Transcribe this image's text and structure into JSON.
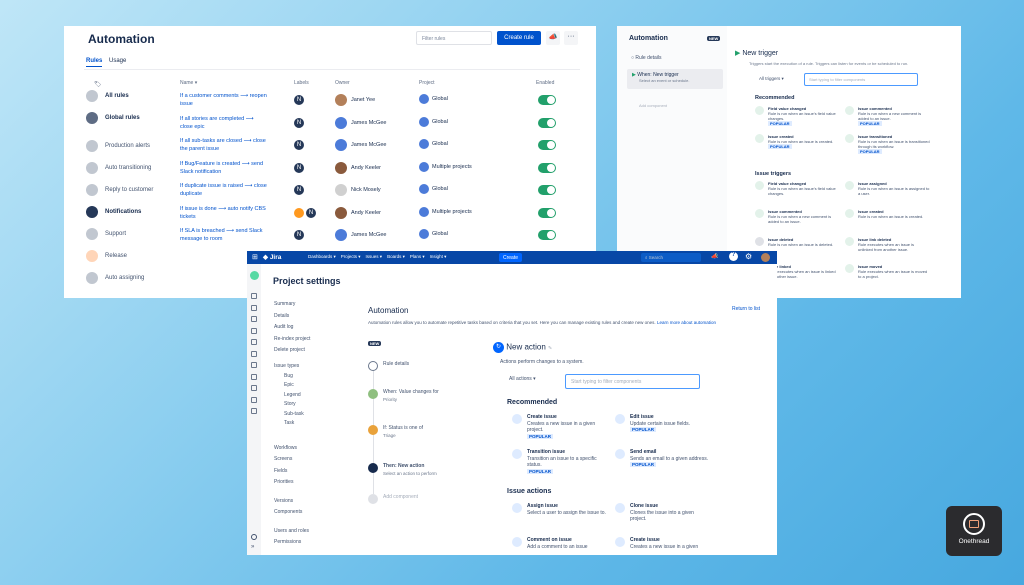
{
  "rules_panel": {
    "title": "Automation",
    "filter_placeholder": "Filter rules",
    "create_rule": "Create rule",
    "tabs": [
      "Rules",
      "Usage"
    ],
    "columns": {
      "name": "Name",
      "labels": "Labels",
      "owner": "Owner",
      "project": "Project",
      "enabled": "Enabled"
    },
    "sidebar": [
      "All rules",
      "Global rules",
      "Production alerts",
      "Auto transitioning",
      "Reply to customer",
      "Notifications",
      "Support",
      "Release",
      "Auto assigning"
    ],
    "sidebar_colors": [
      "#c1c7d0",
      "#5e6c84",
      "#c1c7d0",
      "#c1c7d0",
      "#c1c7d0",
      "#253858",
      "#c1c7d0",
      "#ffd5b8",
      "#c1c7d0"
    ],
    "rows": [
      {
        "name1": "If a customer comments ⟶ reopen",
        "name2": "issue",
        "owner": "Janet Yee",
        "project": "Global"
      },
      {
        "name1": "If all stories are completed ⟶",
        "name2": "close epic",
        "owner": "James McGee",
        "project": "Global"
      },
      {
        "name1": "If all sub-tasks are closed ⟶ close",
        "name2": "the parent issue",
        "owner": "James McGee",
        "project": "Global"
      },
      {
        "name1": "If Bug/Feature is created ⟶ send",
        "name2": "Slack notification",
        "owner": "Andy Keeler",
        "project": "Multiple projects"
      },
      {
        "name1": "If duplicate issue is raised ⟶ close",
        "name2": "duplicate",
        "owner": "Nick Mosely",
        "project": "Global"
      },
      {
        "name1": "If issue is done ⟶ auto notify CBS",
        "name2": "tickets",
        "owner": "Andy Keeler",
        "project": "Multiple projects"
      },
      {
        "name1": "If SLA is breached ⟶ send Slack",
        "name2": "message to room",
        "owner": "James McGee",
        "project": "Global"
      }
    ]
  },
  "trigger_panel": {
    "title": "Automation",
    "badge": "NEW",
    "rule_details": "Rule details",
    "when_title": "When: New trigger",
    "when_sub": "Select an event or schedule.",
    "add_component": "Add component",
    "heading": "New trigger",
    "description": "Triggers start the execution of a rule. Triggers can listen for events or be scheduled to run.",
    "select_label": "All triggers",
    "search_placeholder": "Start typing to filter components",
    "recommended": "Recommended",
    "issue_triggers": "Issue triggers",
    "cards": [
      {
        "t": "Field value changed",
        "d": "Rule is run when an issue's field value changes.",
        "pop": "POPULAR"
      },
      {
        "t": "Issue commented",
        "d": "Rule is run when a new comment is added to an issue.",
        "pop": "POPULAR"
      },
      {
        "t": "Issue created",
        "d": "Rule is run when an issue is created.",
        "pop": "POPULAR"
      },
      {
        "t": "Issue transitioned",
        "d": "Rule is run when an issue is transitioned through its workflow.",
        "pop": "POPULAR"
      },
      {
        "t": "Field value changed",
        "d": "Rule is run when an issue's field value changes.",
        "pop": ""
      },
      {
        "t": "Issue assigned",
        "d": "Rule is run when an issue is assigned to a user.",
        "pop": ""
      },
      {
        "t": "Issue commented",
        "d": "Rule is run when a new comment is added to an issue.",
        "pop": ""
      },
      {
        "t": "Issue created",
        "d": "Rule is run when an issue is created.",
        "pop": ""
      },
      {
        "t": "Issue deleted",
        "d": "Rule is run when an issue is deleted.",
        "pop": ""
      },
      {
        "t": "Issue link deleted",
        "d": "Rule executes when an issue is unlinked from another issue.",
        "pop": ""
      },
      {
        "t": "Issue linked",
        "d": "Rule executes when an issue is linked to another issue.",
        "pop": ""
      },
      {
        "t": "Issue moved",
        "d": "Rule executes when an issue is moved to a project.",
        "pop": ""
      }
    ]
  },
  "project_panel": {
    "brand": "Jira",
    "nav": [
      "Dashboards ▾",
      "Projects ▾",
      "Issues ▾",
      "Boards ▾",
      "Plans ▾",
      "Insight ▾"
    ],
    "create": "Create",
    "search_placeholder": "Search",
    "settings_title": "Project settings",
    "menu1": [
      "Summary",
      "Details",
      "Audit log",
      "Re-index project",
      "Delete project"
    ],
    "issue_types_label": "Issue types",
    "issue_types": [
      "Bug",
      "Epic",
      "Legend",
      "Story",
      "Sub-task",
      "Task"
    ],
    "menu2": [
      "Workflows",
      "Screens",
      "Fields",
      "Priorities"
    ],
    "menu3": [
      "Versions",
      "Components"
    ],
    "menu4": [
      "Users and roles",
      "Permissions"
    ],
    "automation_title": "Automation",
    "return_link": "Return to list",
    "intro": "Automation rules allow you to automate repetitive tasks based on criteria that you set. Here you can manage existing rules and create new ones.",
    "learn_more": "Learn more about automation",
    "badge": "NEW",
    "steps": [
      {
        "t": "Rule details",
        "s": ""
      },
      {
        "t": "When: Value changes for",
        "s": "Priority"
      },
      {
        "t": "If: Status is one of",
        "s": "Triage"
      },
      {
        "t": "Then: New action",
        "s": "Select an action to perform"
      },
      {
        "t": "Add component",
        "s": ""
      }
    ],
    "action_heading": "New action",
    "action_desc": "Actions perform changes to a system.",
    "select_label": "All actions",
    "filter_placeholder": "Start typing to filter components",
    "recommended": "Recommended",
    "issue_actions": "Issue actions",
    "cards": [
      {
        "t": "Create issue",
        "d": "Creates a new issue in a given project.",
        "pop": "POPULAR"
      },
      {
        "t": "Edit issue",
        "d": "Update certain issue fields.",
        "pop": "POPULAR"
      },
      {
        "t": "Transition issue",
        "d": "Transition an issue to a specific status.",
        "pop": "POPULAR"
      },
      {
        "t": "Send email",
        "d": "Sends an email to a given address.",
        "pop": "POPULAR"
      },
      {
        "t": "Assign issue",
        "d": "Select a user to assign the issue to.",
        "pop": ""
      },
      {
        "t": "Clone issue",
        "d": "Clones the issue into a given project.",
        "pop": ""
      },
      {
        "t": "Comment on issue",
        "d": "Add a comment to an issue",
        "pop": ""
      },
      {
        "t": "Create issue",
        "d": "Creates a new issue in a given",
        "pop": ""
      }
    ]
  },
  "watermark": {
    "name": "Onethread"
  }
}
